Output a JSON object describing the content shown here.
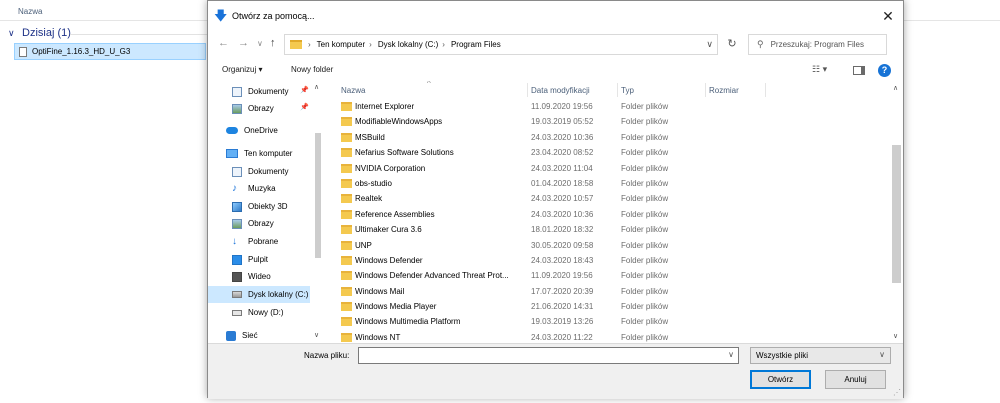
{
  "background": {
    "column_header": "Nazwa",
    "group_label": "Dzisiaj (1)",
    "selected_file": "OptiFine_1.16.3_HD_U_G3"
  },
  "dialog": {
    "title": "Otwórz za pomocą...",
    "breadcrumbs": [
      "Ten komputer",
      "Dysk lokalny (C:)",
      "Program Files"
    ],
    "search_placeholder": "Przeszukaj: Program Files",
    "toolbar": {
      "organize": "Organizuj ▾",
      "new_folder": "Nowy folder"
    },
    "sidebar": [
      {
        "label": "Dokumenty",
        "icon": "document-icon",
        "pinned": true
      },
      {
        "label": "Obrazy",
        "icon": "pictures-icon",
        "pinned": true
      },
      {
        "label": "OneDrive",
        "icon": "cloud-icon",
        "pinned": false
      },
      {
        "label": "Ten komputer",
        "icon": "computer-icon",
        "pinned": false
      },
      {
        "label": "Dokumenty",
        "icon": "document-icon",
        "pinned": false
      },
      {
        "label": "Muzyka",
        "icon": "music-icon",
        "pinned": false
      },
      {
        "label": "Obiekty 3D",
        "icon": "3d-objects-icon",
        "pinned": false
      },
      {
        "label": "Obrazy",
        "icon": "pictures-icon",
        "pinned": false
      },
      {
        "label": "Pobrane",
        "icon": "download-icon",
        "pinned": false
      },
      {
        "label": "Pulpit",
        "icon": "desktop-icon",
        "pinned": false
      },
      {
        "label": "Wideo",
        "icon": "video-icon",
        "pinned": false
      },
      {
        "label": "Dysk lokalny (C:)",
        "icon": "drive-icon",
        "pinned": false,
        "selected": true
      },
      {
        "label": "Nowy (D:)",
        "icon": "drive-icon",
        "pinned": false
      },
      {
        "label": "Sieć",
        "icon": "network-icon",
        "pinned": false
      }
    ],
    "columns": {
      "name": "Nazwa",
      "date": "Data modyfikacji",
      "type": "Typ",
      "size": "Rozmiar"
    },
    "files": [
      {
        "name": "Internet Explorer",
        "date": "11.09.2020 19:56",
        "type": "Folder plików"
      },
      {
        "name": "ModifiableWindowsApps",
        "date": "19.03.2019 05:52",
        "type": "Folder plików"
      },
      {
        "name": "MSBuild",
        "date": "24.03.2020 10:36",
        "type": "Folder plików"
      },
      {
        "name": "Nefarius Software Solutions",
        "date": "23.04.2020 08:52",
        "type": "Folder plików"
      },
      {
        "name": "NVIDIA Corporation",
        "date": "24.03.2020 11:04",
        "type": "Folder plików"
      },
      {
        "name": "obs-studio",
        "date": "01.04.2020 18:58",
        "type": "Folder plików"
      },
      {
        "name": "Realtek",
        "date": "24.03.2020 10:57",
        "type": "Folder plików"
      },
      {
        "name": "Reference Assemblies",
        "date": "24.03.2020 10:36",
        "type": "Folder plików"
      },
      {
        "name": "Ultimaker Cura 3.6",
        "date": "18.01.2020 18:32",
        "type": "Folder plików"
      },
      {
        "name": "UNP",
        "date": "30.05.2020 09:58",
        "type": "Folder plików"
      },
      {
        "name": "Windows Defender",
        "date": "24.03.2020 18:43",
        "type": "Folder plików"
      },
      {
        "name": "Windows Defender Advanced Threat Prot...",
        "date": "11.09.2020 19:56",
        "type": "Folder plików"
      },
      {
        "name": "Windows Mail",
        "date": "17.07.2020 20:39",
        "type": "Folder plików"
      },
      {
        "name": "Windows Media Player",
        "date": "21.06.2020 14:31",
        "type": "Folder plików"
      },
      {
        "name": "Windows Multimedia Platform",
        "date": "19.03.2019 13:26",
        "type": "Folder plików"
      },
      {
        "name": "Windows NT",
        "date": "24.03.2020 11:22",
        "type": "Folder plików"
      }
    ],
    "footer": {
      "filename_label": "Nazwa pliku:",
      "filename_value": "",
      "filter": "Wszystkie pliki",
      "open_button": "Otwórz",
      "cancel_button": "Anuluj"
    }
  },
  "colors": {
    "accent": "#0078d7",
    "selection": "#cce8ff",
    "folder": "#f4c94f"
  }
}
